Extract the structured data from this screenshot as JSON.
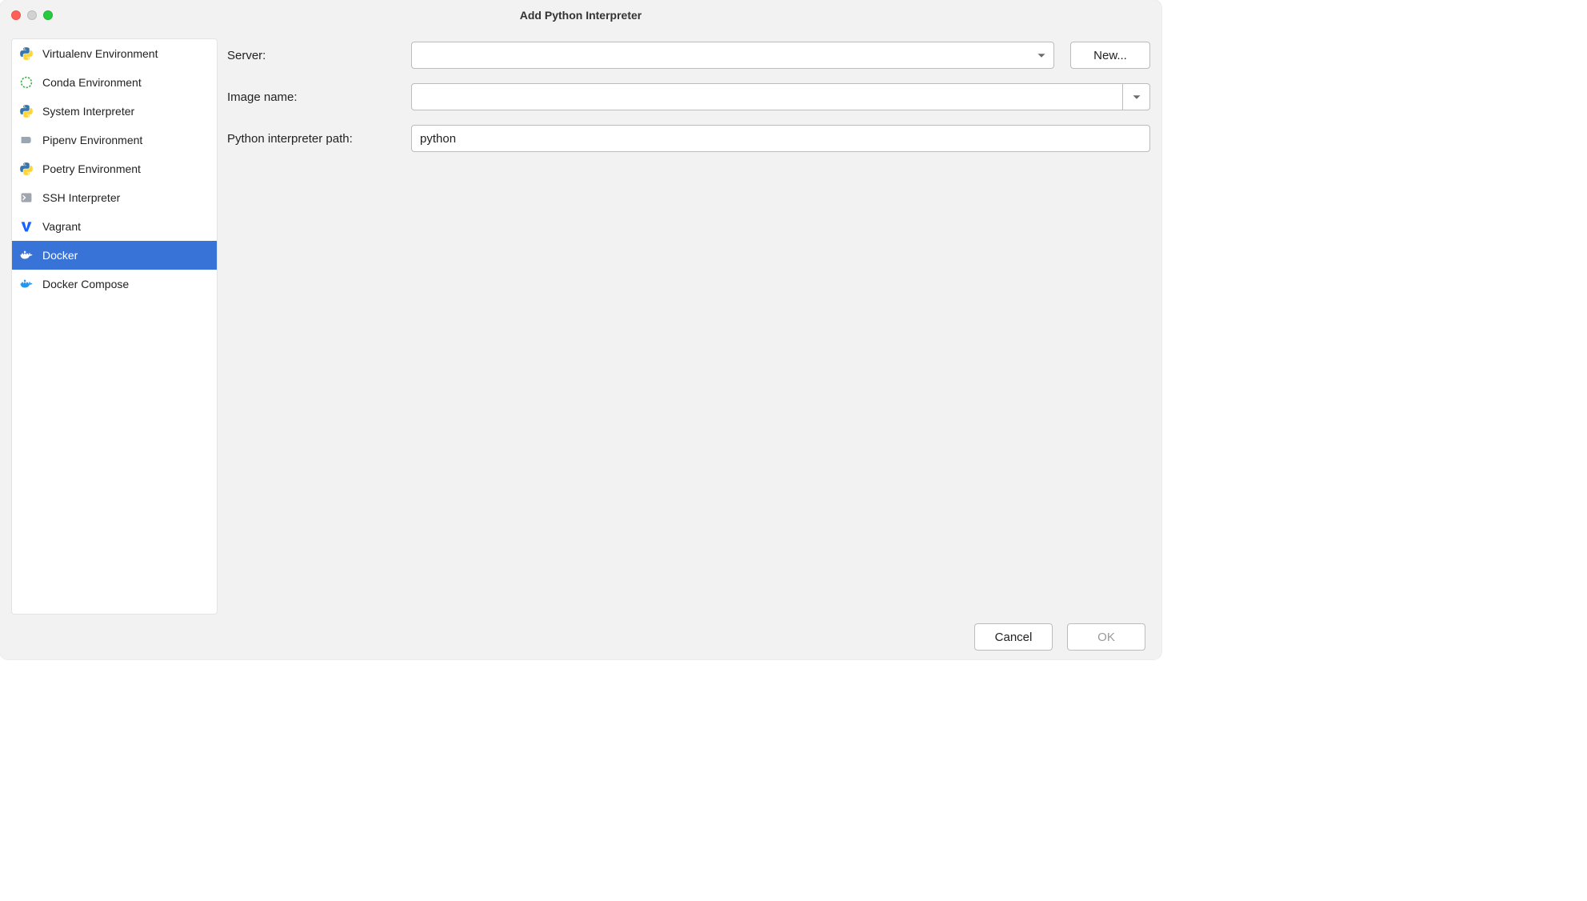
{
  "title": "Add Python Interpreter",
  "sidebar": {
    "items": [
      {
        "label": "Virtualenv Environment",
        "icon": "python"
      },
      {
        "label": "Conda Environment",
        "icon": "conda"
      },
      {
        "label": "System Interpreter",
        "icon": "python"
      },
      {
        "label": "Pipenv Environment",
        "icon": "pipenv"
      },
      {
        "label": "Poetry Environment",
        "icon": "python"
      },
      {
        "label": "SSH Interpreter",
        "icon": "ssh"
      },
      {
        "label": "Vagrant",
        "icon": "vagrant"
      },
      {
        "label": "Docker",
        "icon": "docker",
        "selected": true
      },
      {
        "label": "Docker Compose",
        "icon": "docker"
      }
    ]
  },
  "form": {
    "server": {
      "label": "Server:",
      "value": "",
      "new_button": "New..."
    },
    "image": {
      "label": "Image name:",
      "value": ""
    },
    "path": {
      "label": "Python interpreter path:",
      "value": "python"
    }
  },
  "footer": {
    "cancel": "Cancel",
    "ok": "OK"
  }
}
